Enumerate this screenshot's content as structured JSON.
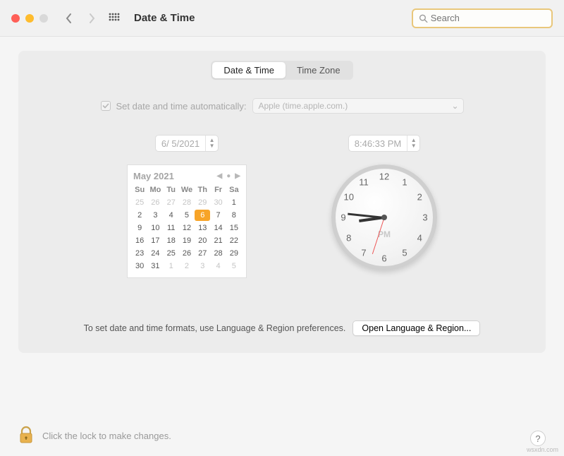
{
  "window": {
    "title": "Date & Time",
    "search_placeholder": "Search"
  },
  "tabs": {
    "date_time": "Date & Time",
    "time_zone": "Time Zone",
    "active": "date_time"
  },
  "auto": {
    "label": "Set date and time automatically:",
    "checked": true,
    "server": "Apple (time.apple.com.)"
  },
  "date_input": "6/  5/2021",
  "time_input": "8:46:33 PM",
  "calendar": {
    "month_label": "May 2021",
    "dow": [
      "Su",
      "Mo",
      "Tu",
      "We",
      "Th",
      "Fr",
      "Sa"
    ],
    "cells": [
      {
        "n": "25",
        "mute": true
      },
      {
        "n": "26",
        "mute": true
      },
      {
        "n": "27",
        "mute": true
      },
      {
        "n": "28",
        "mute": true
      },
      {
        "n": "29",
        "mute": true
      },
      {
        "n": "30",
        "mute": true
      },
      {
        "n": "1"
      },
      {
        "n": "2"
      },
      {
        "n": "3"
      },
      {
        "n": "4"
      },
      {
        "n": "5"
      },
      {
        "n": "6",
        "today": true
      },
      {
        "n": "7"
      },
      {
        "n": "8"
      },
      {
        "n": "9"
      },
      {
        "n": "10"
      },
      {
        "n": "11"
      },
      {
        "n": "12"
      },
      {
        "n": "13"
      },
      {
        "n": "14"
      },
      {
        "n": "15"
      },
      {
        "n": "16"
      },
      {
        "n": "17"
      },
      {
        "n": "18"
      },
      {
        "n": "19"
      },
      {
        "n": "20"
      },
      {
        "n": "21"
      },
      {
        "n": "22"
      },
      {
        "n": "23"
      },
      {
        "n": "24"
      },
      {
        "n": "25"
      },
      {
        "n": "26"
      },
      {
        "n": "27"
      },
      {
        "n": "28"
      },
      {
        "n": "29"
      },
      {
        "n": "30"
      },
      {
        "n": "31"
      },
      {
        "n": "1",
        "mute": true
      },
      {
        "n": "2",
        "mute": true
      },
      {
        "n": "3",
        "mute": true
      },
      {
        "n": "4",
        "mute": true
      },
      {
        "n": "5",
        "mute": true
      }
    ]
  },
  "clock": {
    "ampm": "PM",
    "hour_angle": 172,
    "minute_angle": 186,
    "second_angle": 108
  },
  "footer": {
    "hint": "To set date and time formats, use Language & Region preferences.",
    "button": "Open Language & Region..."
  },
  "lock_hint": "Click the lock to make changes.",
  "watermark": "wsxdn.com"
}
